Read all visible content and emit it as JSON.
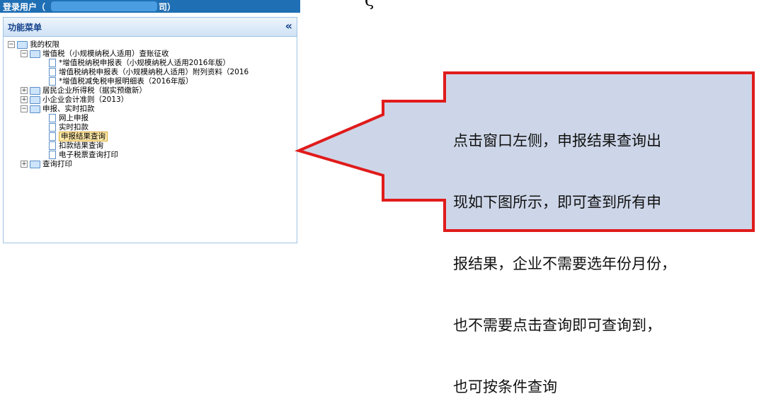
{
  "topbar": {
    "login_label": "登录用户（",
    "suffix": "司）"
  },
  "panel": {
    "title": "功能菜单",
    "collapse_symbol": "«"
  },
  "tree": {
    "root": "我的权限",
    "vat": "增值税（小规模纳税人适用）查账征收",
    "vat_items": [
      "*增值税纳税申报表（小规模纳税人适用2016年版）",
      "增值税纳税申报表（小规模纳税人适用）附列资料（2016",
      "*增值税减免税申报明细表（2016年版）"
    ],
    "income_tax": "居民企业所得税（据实预缴新）",
    "accounting": "小企业会计准则（2013）",
    "declare": "申报、实时扣款",
    "declare_items": [
      "网上申报",
      "实时扣款",
      "申报结果查询",
      "扣款结果查询",
      "电子税票查询打印"
    ],
    "query_print": "查询打印"
  },
  "heading_fragment": "ζˇ",
  "callout": {
    "lines": [
      "点击窗口左侧，申报结果查询出",
      "现如下图所示，即可查到所有申",
      "报结果，企业不需要选年份月份，",
      "也不需要点击查询即可查询到，",
      "也可按条件查询"
    ],
    "border_color": "#e01b1b",
    "fill_color": "#cdd6e8"
  }
}
